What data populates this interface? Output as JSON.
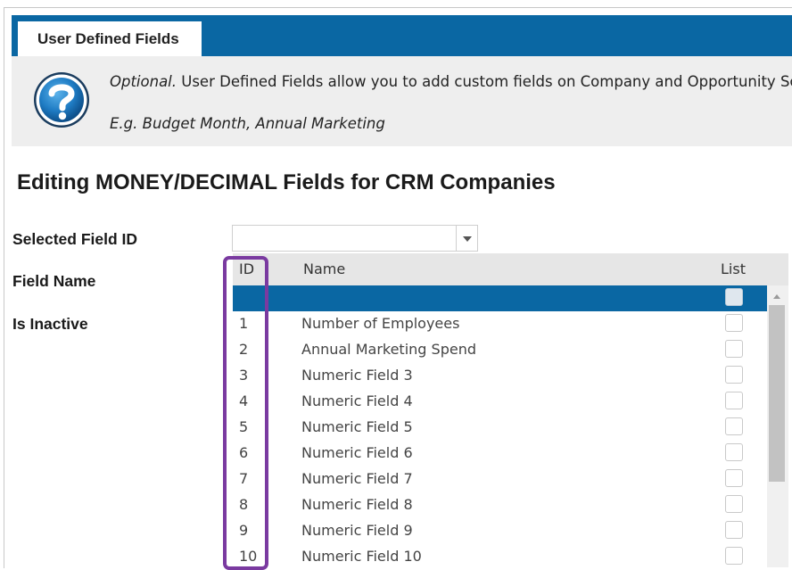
{
  "tabs": [
    {
      "label": "User Defined Fields",
      "active": true
    }
  ],
  "help": {
    "icon": "question-icon",
    "optional_label": "Optional.",
    "description": " User Defined Fields allow you to add custom fields on Company and Opportunity Screens",
    "example": "E.g. Budget Month, Annual Marketing"
  },
  "section_title": "Editing MONEY/DECIMAL Fields for CRM Companies",
  "form": {
    "selected_field_label": "Selected Field ID",
    "selected_field_value": "",
    "field_name_label": "Field Name",
    "is_inactive_label": "Is Inactive"
  },
  "grid": {
    "columns": {
      "id": "ID",
      "name": "Name",
      "list": "List"
    },
    "rows": [
      {
        "id": "",
        "name": "",
        "list": false,
        "selected": true
      },
      {
        "id": "1",
        "name": "Number of Employees",
        "list": false
      },
      {
        "id": "2",
        "name": "Annual Marketing Spend",
        "list": false
      },
      {
        "id": "3",
        "name": "Numeric Field 3",
        "list": false
      },
      {
        "id": "4",
        "name": "Numeric Field 4",
        "list": false
      },
      {
        "id": "5",
        "name": "Numeric Field 5",
        "list": false
      },
      {
        "id": "6",
        "name": "Numeric Field 6",
        "list": false
      },
      {
        "id": "7",
        "name": "Numeric Field 7",
        "list": false
      },
      {
        "id": "8",
        "name": "Numeric Field 8",
        "list": false
      },
      {
        "id": "9",
        "name": "Numeric Field 9",
        "list": false
      },
      {
        "id": "10",
        "name": "Numeric Field 10",
        "list": false
      }
    ]
  },
  "colors": {
    "accent": "#0a67a3",
    "highlight": "#7a3aa0",
    "panel": "#eeeeee"
  }
}
